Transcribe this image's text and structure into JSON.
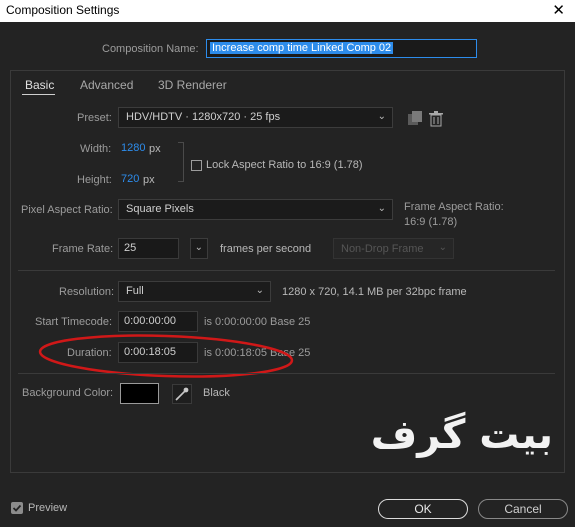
{
  "window": {
    "title": "Composition Settings",
    "close": "✕"
  },
  "composition_name": {
    "label": "Composition Name:",
    "value": "Increase comp time Linked Comp 02"
  },
  "tabs": [
    {
      "label": "Basic"
    },
    {
      "label": "Advanced"
    },
    {
      "label": "3D Renderer"
    }
  ],
  "preset": {
    "label": "Preset:",
    "value": "HDV/HDTV · 1280x720 · 25 fps"
  },
  "width": {
    "label": "Width:",
    "value": "1280",
    "unit": "px"
  },
  "height": {
    "label": "Height:",
    "value": "720",
    "unit": "px"
  },
  "lock_aspect": {
    "label": "Lock Aspect Ratio to 16:9 (1.78)",
    "checked": false
  },
  "pixel_aspect": {
    "label": "Pixel Aspect Ratio:",
    "value": "Square Pixels"
  },
  "frame_aspect": {
    "label": "Frame Aspect Ratio:",
    "value": "16:9 (1.78)"
  },
  "frame_rate": {
    "label": "Frame Rate:",
    "value": "25",
    "unit": "frames per second",
    "drop_frame": "Non-Drop Frame"
  },
  "resolution": {
    "label": "Resolution:",
    "value": "Full",
    "info": "1280 x 720, 14.1 MB per 32bpc frame"
  },
  "start_timecode": {
    "label": "Start Timecode:",
    "value": "0:00:00:00",
    "info": "is 0:00:00:00  Base 25"
  },
  "duration": {
    "label": "Duration:",
    "value": "0:00:18:05",
    "info": "is 0:00:18:05  Base 25"
  },
  "background_color": {
    "label": "Background Color:",
    "color_name": "Black",
    "color": "#000000"
  },
  "preview": {
    "label": "Preview",
    "checked": true
  },
  "buttons": {
    "ok": "OK",
    "cancel": "Cancel"
  },
  "watermark": "بیت گرف",
  "colors": {
    "accent": "#2d8ceb",
    "annotation": "#d01818"
  }
}
